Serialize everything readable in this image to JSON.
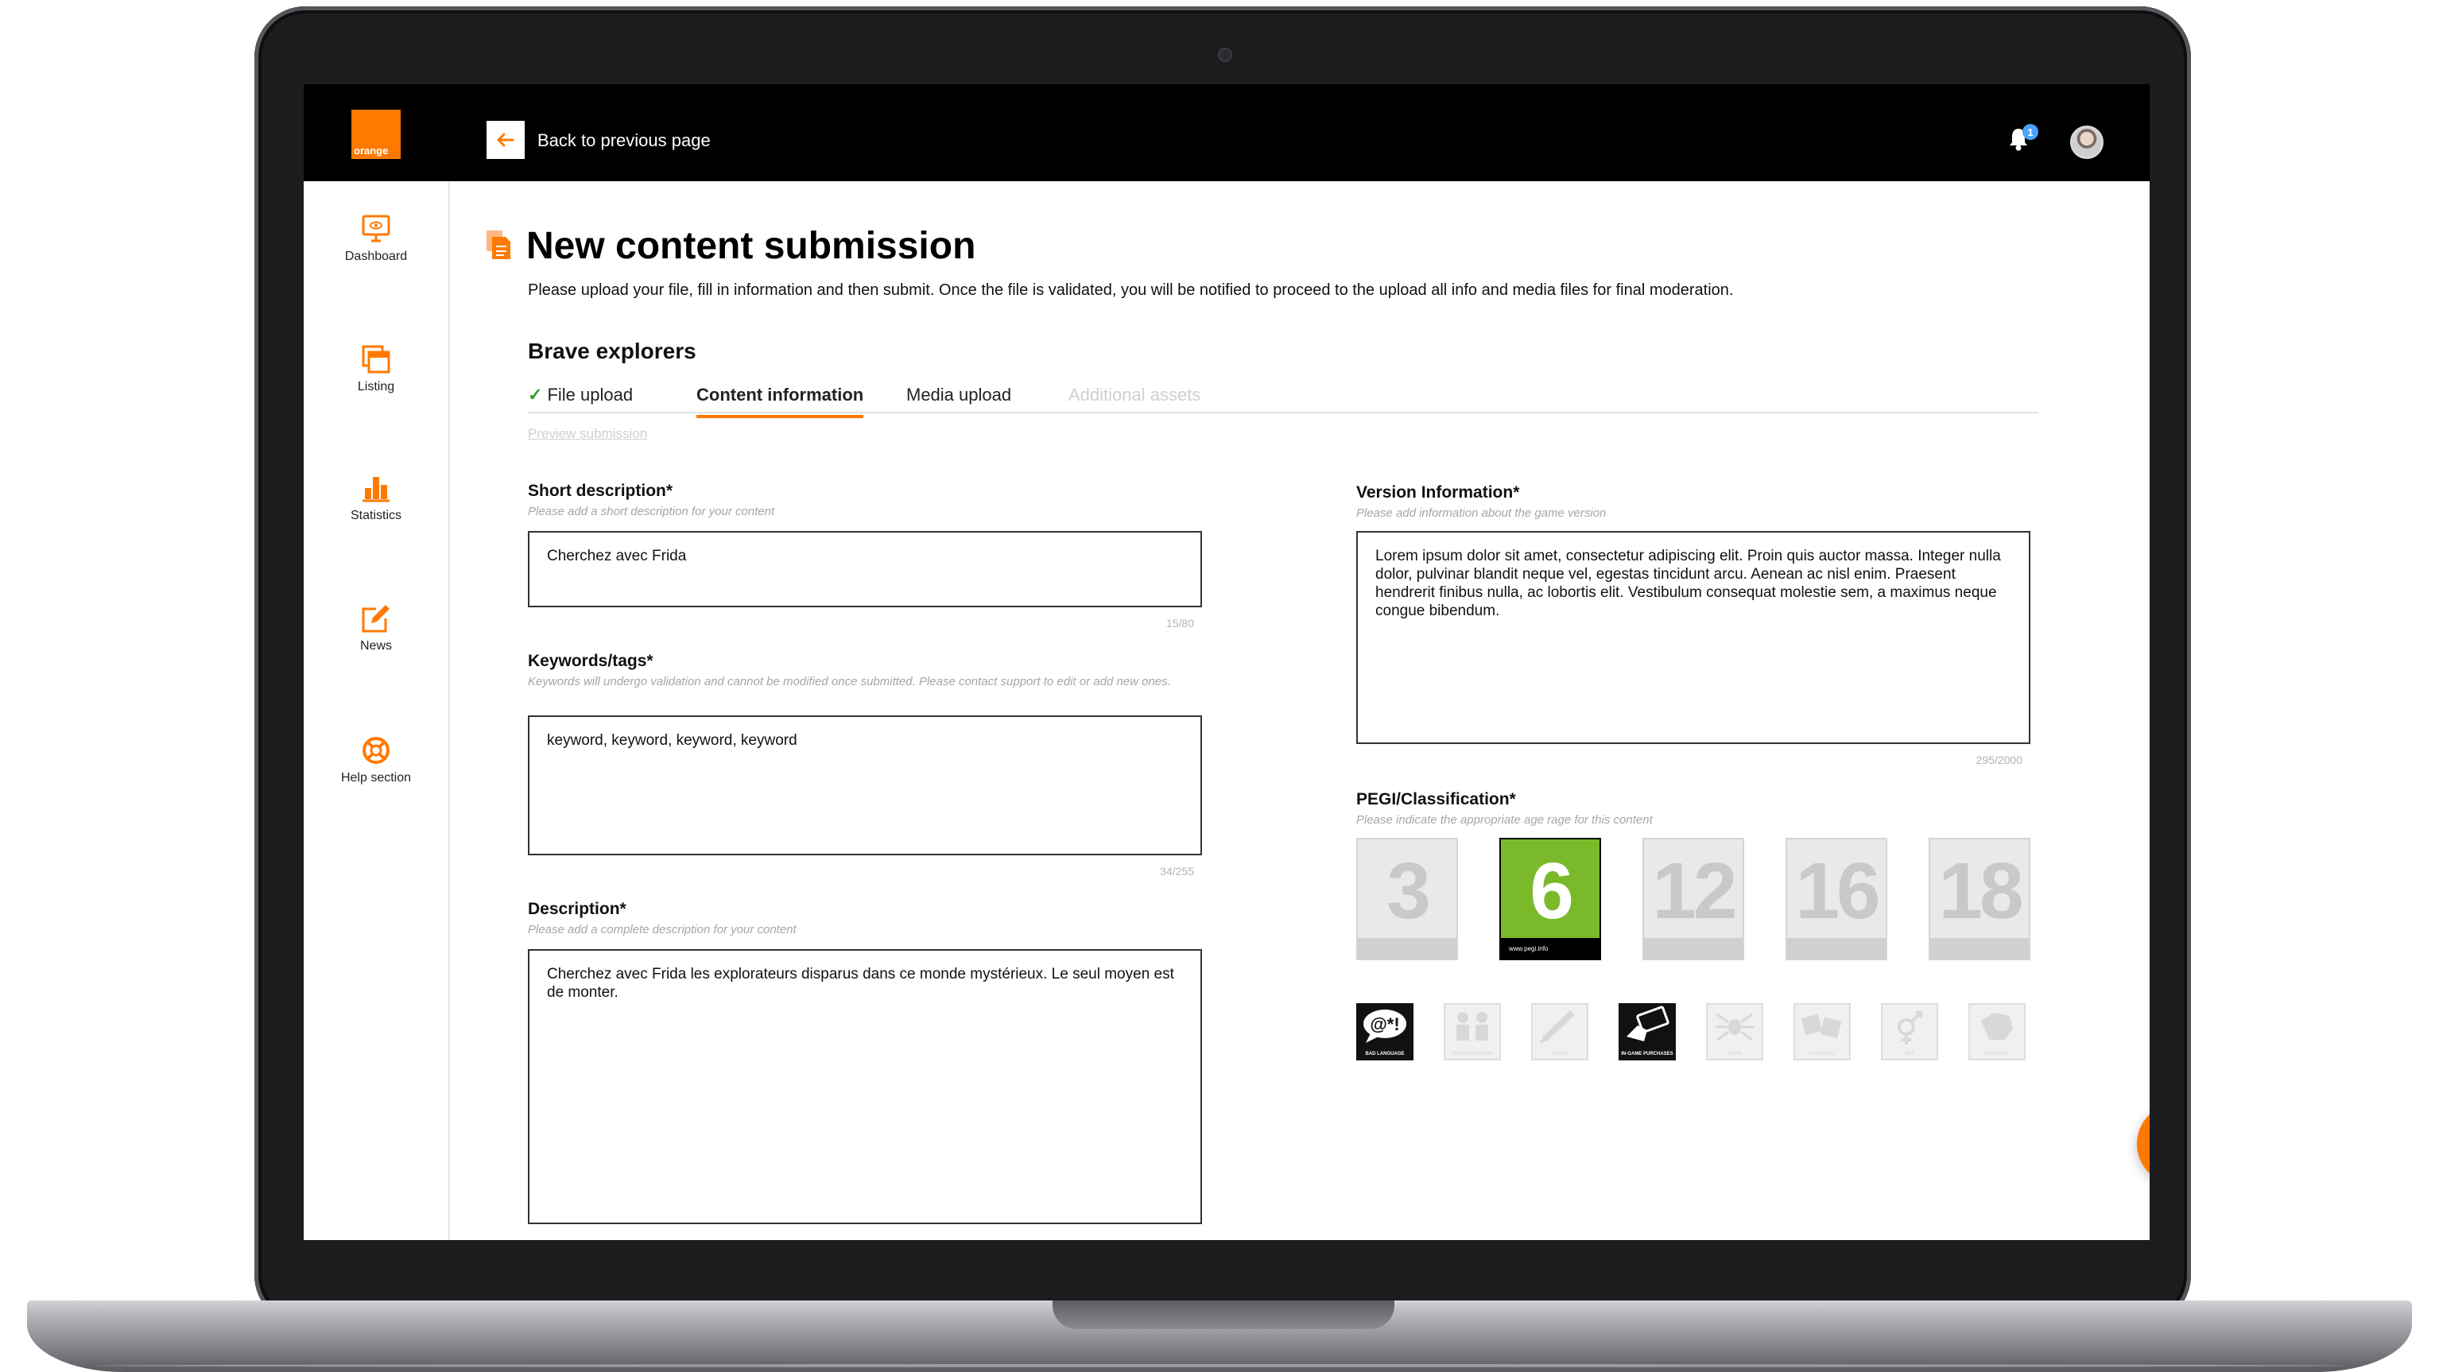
{
  "header": {
    "logo_text": "orange",
    "back_label": "Back to previous page",
    "notification_count": "1"
  },
  "sidebar": {
    "items": [
      {
        "label": "Dashboard",
        "icon": "monitor-icon"
      },
      {
        "label": "Listing",
        "icon": "listing-icon"
      },
      {
        "label": "Statistics",
        "icon": "bar-chart-icon"
      },
      {
        "label": "News",
        "icon": "edit-icon"
      },
      {
        "label": "Help section",
        "icon": "lifebuoy-icon"
      }
    ]
  },
  "page": {
    "title": "New content submission",
    "subtitle": "Please upload your file, fill in information and then submit. Once the file is validated, you will be notified to proceed to the upload all info and media files for final moderation.",
    "game_name": "Brave explorers",
    "tabs": [
      {
        "label": "File upload",
        "state": "done"
      },
      {
        "label": "Content information",
        "state": "active"
      },
      {
        "label": "Media upload",
        "state": "default"
      },
      {
        "label": "Additional assets",
        "state": "disabled"
      }
    ],
    "preview_link": "Preview submission"
  },
  "form": {
    "short_description": {
      "label": "Short description*",
      "hint": "Please add a short description for your content",
      "value": "Cherchez avec Frida",
      "counter": "15/80"
    },
    "keywords": {
      "label": "Keywords/tags*",
      "hint": "Keywords will undergo validation and cannot be modified once submitted. Please contact support to edit or add new ones.",
      "value": "keyword, keyword, keyword, keyword",
      "counter": "34/255"
    },
    "description": {
      "label": "Description*",
      "hint": "Please add a complete description for your content",
      "value": "Cherchez avec Frida les explorateurs disparus dans ce monde mystérieux. Le seul moyen est de monter."
    },
    "version_info": {
      "label": "Version Information*",
      "hint": "Please add information about the game version",
      "value": "Lorem ipsum dolor sit amet, consectetur adipiscing elit. Proin quis auctor massa. Integer nulla dolor, pulvinar blandit neque vel, egestas tincidunt arcu. Aenean ac nisl enim. Praesent hendrerit finibus nulla, ac lobortis elit. Vestibulum consequat molestie sem, a maximus neque congue bibendum.",
      "counter": "295/2000"
    },
    "pegi": {
      "label": "PEGI/Classification*",
      "hint": "Please indicate the appropriate age rage for this content",
      "ratings": [
        "3",
        "6",
        "12",
        "16",
        "18"
      ],
      "selected": "6",
      "selected_color": "#7ab929",
      "site_text": "www.pegi.info",
      "descriptors": [
        {
          "caption": "BAD LANGUAGE",
          "active": true
        },
        {
          "caption": "DISCRIMINATION",
          "active": false
        },
        {
          "caption": "DRUGS",
          "active": false
        },
        {
          "caption": "IN-GAME PURCHASES",
          "active": true
        },
        {
          "caption": "FEAR",
          "active": false
        },
        {
          "caption": "GAMBLING",
          "active": false
        },
        {
          "caption": "SEX",
          "active": false
        },
        {
          "caption": "VIOLENCE",
          "active": false
        }
      ]
    }
  },
  "theme": {
    "accent": "#ff7900",
    "topbar": "#000000"
  }
}
